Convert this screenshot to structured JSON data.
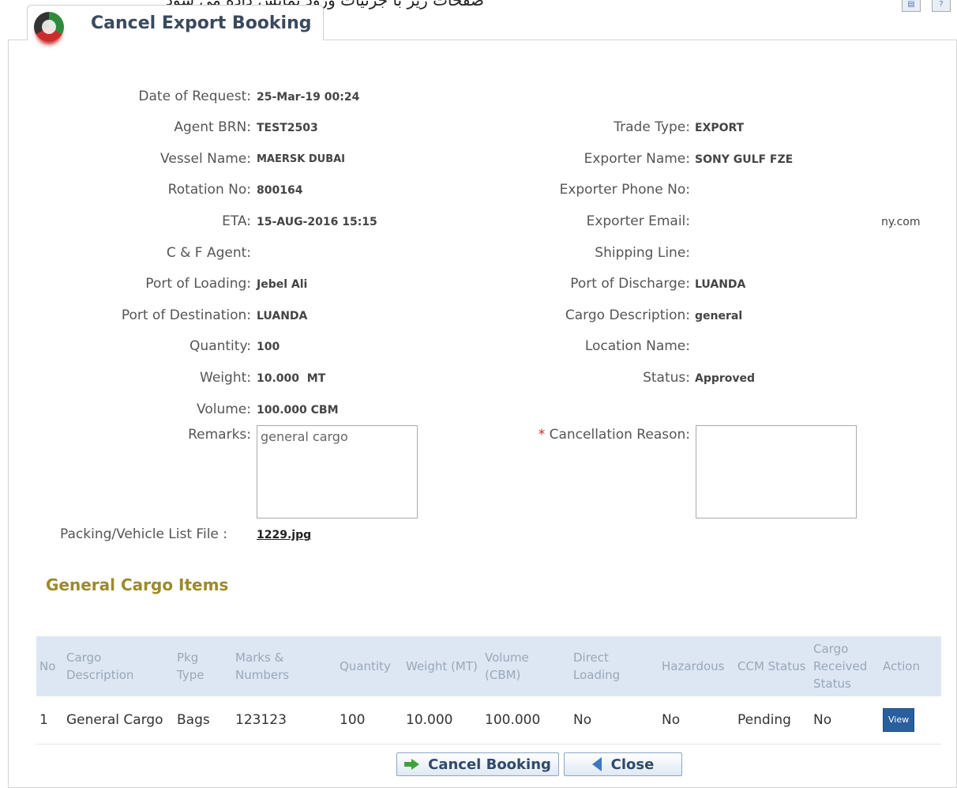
{
  "top_banner": "صفحات زیر با جزئیات ورود نمایش داده می شود",
  "header": {
    "title": "Cancel Export Booking"
  },
  "left_fields": [
    {
      "label": "Date of Request:",
      "value": "25-Mar-19 00:24"
    },
    {
      "label": "Agent BRN:",
      "value": "TEST2503"
    },
    {
      "label": "Vessel Name:",
      "value": "MAERSK DUBAI"
    },
    {
      "label": "Rotation No:",
      "value": "800164"
    },
    {
      "label": "ETA:",
      "value": "15-AUG-2016 15:15"
    },
    {
      "label": "C & F Agent:",
      "value": ""
    },
    {
      "label": "Port of Loading:",
      "value": "Jebel Ali"
    },
    {
      "label": "Port of Destination:",
      "value": "LUANDA"
    },
    {
      "label": "Quantity:",
      "value": "100"
    },
    {
      "label": "Weight:",
      "value": "10.000  MT"
    },
    {
      "label": "Volume:",
      "value": "100.000 CBM"
    }
  ],
  "right_fields": [
    {
      "label": "Trade Type:",
      "value": "EXPORT"
    },
    {
      "label": "Exporter Name:",
      "value": "SONY GULF FZE"
    },
    {
      "label": "Exporter Phone No:",
      "value": ""
    },
    {
      "label": "Exporter Email:",
      "value": "ny.com"
    },
    {
      "label": "Shipping Line:",
      "value": ""
    },
    {
      "label": "Port of Discharge:",
      "value": "LUANDA"
    },
    {
      "label": "Cargo Description:",
      "value": "general"
    },
    {
      "label": "Location Name:",
      "value": ""
    },
    {
      "label": "Status:",
      "value": "Approved"
    }
  ],
  "remarks": {
    "label": "Remarks:",
    "value": "general cargo"
  },
  "cancellation": {
    "required_mark": "*",
    "label": "Cancellation Reason:",
    "value": ""
  },
  "packing": {
    "label": "Packing/Vehicle List File :",
    "file": "1229.jpg"
  },
  "section_title": "General Cargo Items",
  "table": {
    "headers": [
      "No",
      "Cargo Description",
      "Pkg Type",
      "Marks & Numbers",
      "Quantity",
      "Weight (MT)",
      "Volume (CBM)",
      "Direct Loading",
      "Hazardous",
      "CCM Status",
      "Cargo Received Status",
      "Action"
    ],
    "rows": [
      [
        "1",
        "General Cargo",
        "Bags",
        "123123",
        "100",
        "10.000",
        "100.000",
        "No",
        "No",
        "Pending",
        "No",
        "View"
      ]
    ]
  },
  "buttons": {
    "cancel_booking": "Cancel Booking",
    "close": "Close"
  }
}
